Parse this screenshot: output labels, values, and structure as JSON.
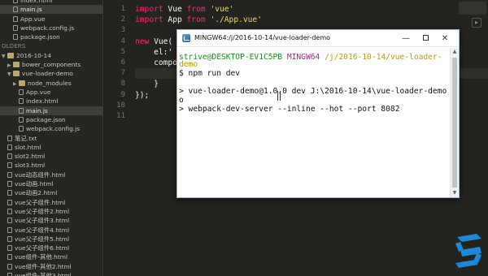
{
  "sidebar": {
    "rows": [
      {
        "label": "index.html",
        "type": "file",
        "indent": 2,
        "selected": false
      },
      {
        "label": "main.js",
        "type": "file",
        "indent": 2,
        "selected": true
      },
      {
        "label": "App.vue",
        "type": "file",
        "indent": 2,
        "selected": false
      },
      {
        "label": "webpack.config.js",
        "type": "file",
        "indent": 2,
        "selected": false
      },
      {
        "label": "package.json",
        "type": "file",
        "indent": 2,
        "selected": false
      },
      {
        "label": "OLDERS",
        "type": "header",
        "indent": 0,
        "selected": false
      },
      {
        "label": "2016-10-14",
        "type": "folder",
        "indent": 0,
        "arrow": "▼",
        "selected": false
      },
      {
        "label": "bower_components",
        "type": "folder",
        "indent": 1,
        "arrow": "▶",
        "selected": false
      },
      {
        "label": "vue-loader-demo",
        "type": "folder",
        "indent": 1,
        "arrow": "▼",
        "selected": false
      },
      {
        "label": "node_modules",
        "type": "folder",
        "indent": 2,
        "arrow": "▶",
        "selected": false
      },
      {
        "label": "App.vue",
        "type": "file",
        "indent": 3,
        "selected": false
      },
      {
        "label": "index.html",
        "type": "file",
        "indent": 3,
        "selected": false
      },
      {
        "label": "main.js",
        "type": "file",
        "indent": 3,
        "selected": true
      },
      {
        "label": "package.json",
        "type": "file",
        "indent": 3,
        "selected": false
      },
      {
        "label": "webpack.config.js",
        "type": "file",
        "indent": 3,
        "selected": false
      },
      {
        "label": "笔记.txt",
        "type": "file",
        "indent": 1,
        "selected": false
      },
      {
        "label": "slot.html",
        "type": "file",
        "indent": 1,
        "selected": false
      },
      {
        "label": "slot2.html",
        "type": "file",
        "indent": 1,
        "selected": false
      },
      {
        "label": "slot3.html",
        "type": "file",
        "indent": 1,
        "selected": false
      },
      {
        "label": "vue动态组件.html",
        "type": "file",
        "indent": 1,
        "selected": false
      },
      {
        "label": "vue动画.html",
        "type": "file",
        "indent": 1,
        "selected": false
      },
      {
        "label": "vue动画2.html",
        "type": "file",
        "indent": 1,
        "selected": false
      },
      {
        "label": "vue父子组件.html",
        "type": "file",
        "indent": 1,
        "selected": false
      },
      {
        "label": "vue父子组件2.html",
        "type": "file",
        "indent": 1,
        "selected": false
      },
      {
        "label": "vue父子组件3.html",
        "type": "file",
        "indent": 1,
        "selected": false
      },
      {
        "label": "vue父子组件4.html",
        "type": "file",
        "indent": 1,
        "selected": false
      },
      {
        "label": "vue父子组件5.html",
        "type": "file",
        "indent": 1,
        "selected": false
      },
      {
        "label": "vue父子组件6.html",
        "type": "file",
        "indent": 1,
        "selected": false
      },
      {
        "label": "vue组件-其他.html",
        "type": "file",
        "indent": 1,
        "selected": false
      },
      {
        "label": "vue组件-其他2.html",
        "type": "file",
        "indent": 1,
        "selected": false
      },
      {
        "label": "vue组件-其他3.html",
        "type": "file",
        "indent": 1,
        "selected": false
      }
    ]
  },
  "editor": {
    "line_numbers": [
      "1",
      "2",
      "3",
      "4",
      "5",
      "6",
      "7",
      "8",
      "9",
      "10",
      "11"
    ],
    "lines": [
      [
        {
          "t": "import",
          "c": "kw"
        },
        {
          "t": " Vue ",
          "c": "plain"
        },
        {
          "t": "from",
          "c": "kw"
        },
        {
          "t": " ",
          "c": "plain"
        },
        {
          "t": "'vue'",
          "c": "str"
        }
      ],
      [
        {
          "t": "import",
          "c": "kw"
        },
        {
          "t": " App ",
          "c": "plain"
        },
        {
          "t": "from",
          "c": "kw"
        },
        {
          "t": " ",
          "c": "plain"
        },
        {
          "t": "'./App.vue'",
          "c": "str"
        }
      ],
      [],
      [
        {
          "t": "new",
          "c": "kw"
        },
        {
          "t": " Vue(",
          "c": "plain"
        }
      ],
      [
        {
          "t": "    el:'",
          "c": "plain"
        }
      ],
      [
        {
          "t": "    compo",
          "c": "plain"
        }
      ],
      [],
      [
        {
          "t": "    }",
          "c": "plain"
        }
      ],
      [
        {
          "t": "});",
          "c": "plain"
        }
      ],
      [],
      []
    ],
    "toggle_glyph": "▸"
  },
  "terminal": {
    "title": "MINGW64:/j/2016-10-14/vue-loader-demo",
    "minimize_glyph": "—",
    "close_glyph": "✕",
    "prompt": {
      "user": "strive@DESKTOP-EV1C5PB",
      "host": "MINGW64",
      "path": "/j/2016-10-14/vue-loader-",
      "path_wrap": "demo"
    },
    "command": "$ npm run dev",
    "output": [
      "> vue-loader-demo@1.0.0 dev J:\\2016-10-14\\vue-loader-demo",
      "o",
      "> webpack-dev-server --inline --hot --port 8082"
    ],
    "scroll_up": "▲",
    "scroll_down": "▼"
  },
  "colors": {
    "accent_logo": "#1e88d6"
  }
}
